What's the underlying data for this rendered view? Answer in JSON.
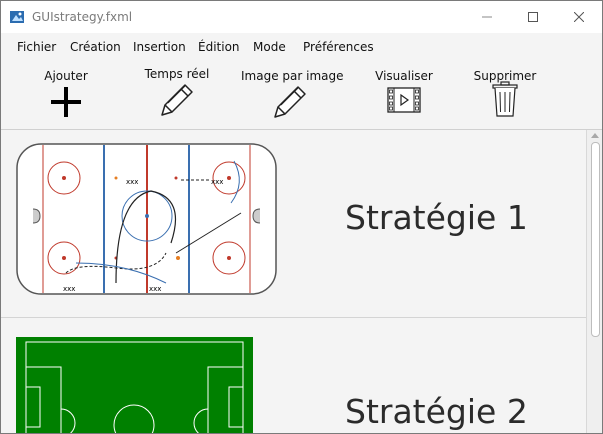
{
  "window": {
    "title": "GUIstrategy.fxml"
  },
  "menu": {
    "items": [
      "Fichier",
      "Création",
      "Insertion",
      "Édition",
      "Mode",
      "Préférences"
    ]
  },
  "toolbar": {
    "tools": [
      {
        "label": "Ajouter",
        "icon": "plus-icon"
      },
      {
        "label": "Temps réel",
        "icon": "pencil-icon"
      },
      {
        "label": "Image par image",
        "icon": "pencil-icon"
      },
      {
        "label": "Visualiser",
        "icon": "film-icon"
      },
      {
        "label": "Supprimer",
        "icon": "trash-icon"
      }
    ]
  },
  "strategies": [
    {
      "title": "Stratégie 1",
      "sport": "hockey",
      "rink_image": "hockey-rink-play-diagram"
    },
    {
      "title": "Stratégie 2",
      "sport": "soccer",
      "field_color": "#008000"
    }
  ],
  "colors": {
    "hockey_red": "#c0392b",
    "hockey_blue": "#3a6fb0",
    "soccer_green": "#008000"
  }
}
